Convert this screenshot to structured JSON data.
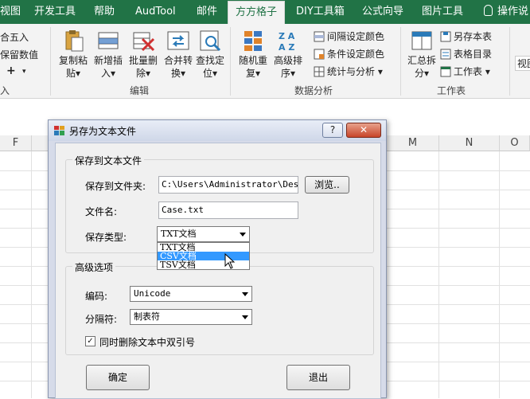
{
  "ribbon_tabs": [
    {
      "label": "视图"
    },
    {
      "label": "开发工具"
    },
    {
      "label": "帮助"
    },
    {
      "label": "AudTool"
    },
    {
      "label": "邮件"
    },
    {
      "label": "方方格子"
    },
    {
      "label": "DIY工具箱"
    },
    {
      "label": "公式向导"
    },
    {
      "label": "图片工具"
    },
    {
      "label": "操作说"
    }
  ],
  "ribbon": {
    "left_items": {
      "round": "合五入",
      "keep": "保留数值",
      "plus": "+",
      "partial_label": "入"
    },
    "edit_group": {
      "label": "编辑",
      "buttons": [
        {
          "line1": "复制粘",
          "line2": "贴▾"
        },
        {
          "line1": "新增插",
          "line2": "入▾"
        },
        {
          "line1": "批量删",
          "line2": "除▾"
        },
        {
          "line1": "合并转",
          "line2": "换▾"
        },
        {
          "line1": "查找定",
          "line2": "位▾"
        }
      ]
    },
    "analysis_group": {
      "label": "数据分析",
      "buttons": [
        {
          "line1": "随机重",
          "line2": "复▾"
        },
        {
          "line1": "高级排",
          "line2": "序▾"
        }
      ],
      "small": [
        "间隔设定颜色",
        "条件设定颜色",
        "统计与分析 ▾"
      ]
    },
    "worksheet_group": {
      "label": "工作表",
      "button": {
        "line1": "汇总拆",
        "line2": "分▾"
      },
      "small": [
        "另存本表",
        "表格目录",
        "工作表 ▾"
      ],
      "extra": "视图"
    }
  },
  "sheet": {
    "columns": [
      "F",
      "M",
      "N",
      "O"
    ]
  },
  "dialog": {
    "title": "另存为文本文件",
    "help_btn": "?",
    "close_btn": "✕",
    "save_section": {
      "legend": "保存到文本文件",
      "folder_label": "保存到文件夹:",
      "folder_value": "C:\\Users\\Administrator\\Deskto",
      "browse_label": "浏览..",
      "filename_label": "文件名:",
      "filename_value": "Case.txt",
      "type_label": "保存类型:",
      "type_value": "TXT文档",
      "type_options": [
        "TXT文档",
        "CSV文档",
        "TSV文档"
      ]
    },
    "advanced_section": {
      "legend": "高级选项",
      "encoding_label": "编码:",
      "encoding_value": "Unicode",
      "delimiter_label": "分隔符:",
      "delimiter_value": "制表符",
      "remove_quotes_label": "同时删除文本中双引号",
      "remove_quotes_checked": "✓"
    },
    "ok_label": "确定",
    "exit_label": "退出"
  }
}
